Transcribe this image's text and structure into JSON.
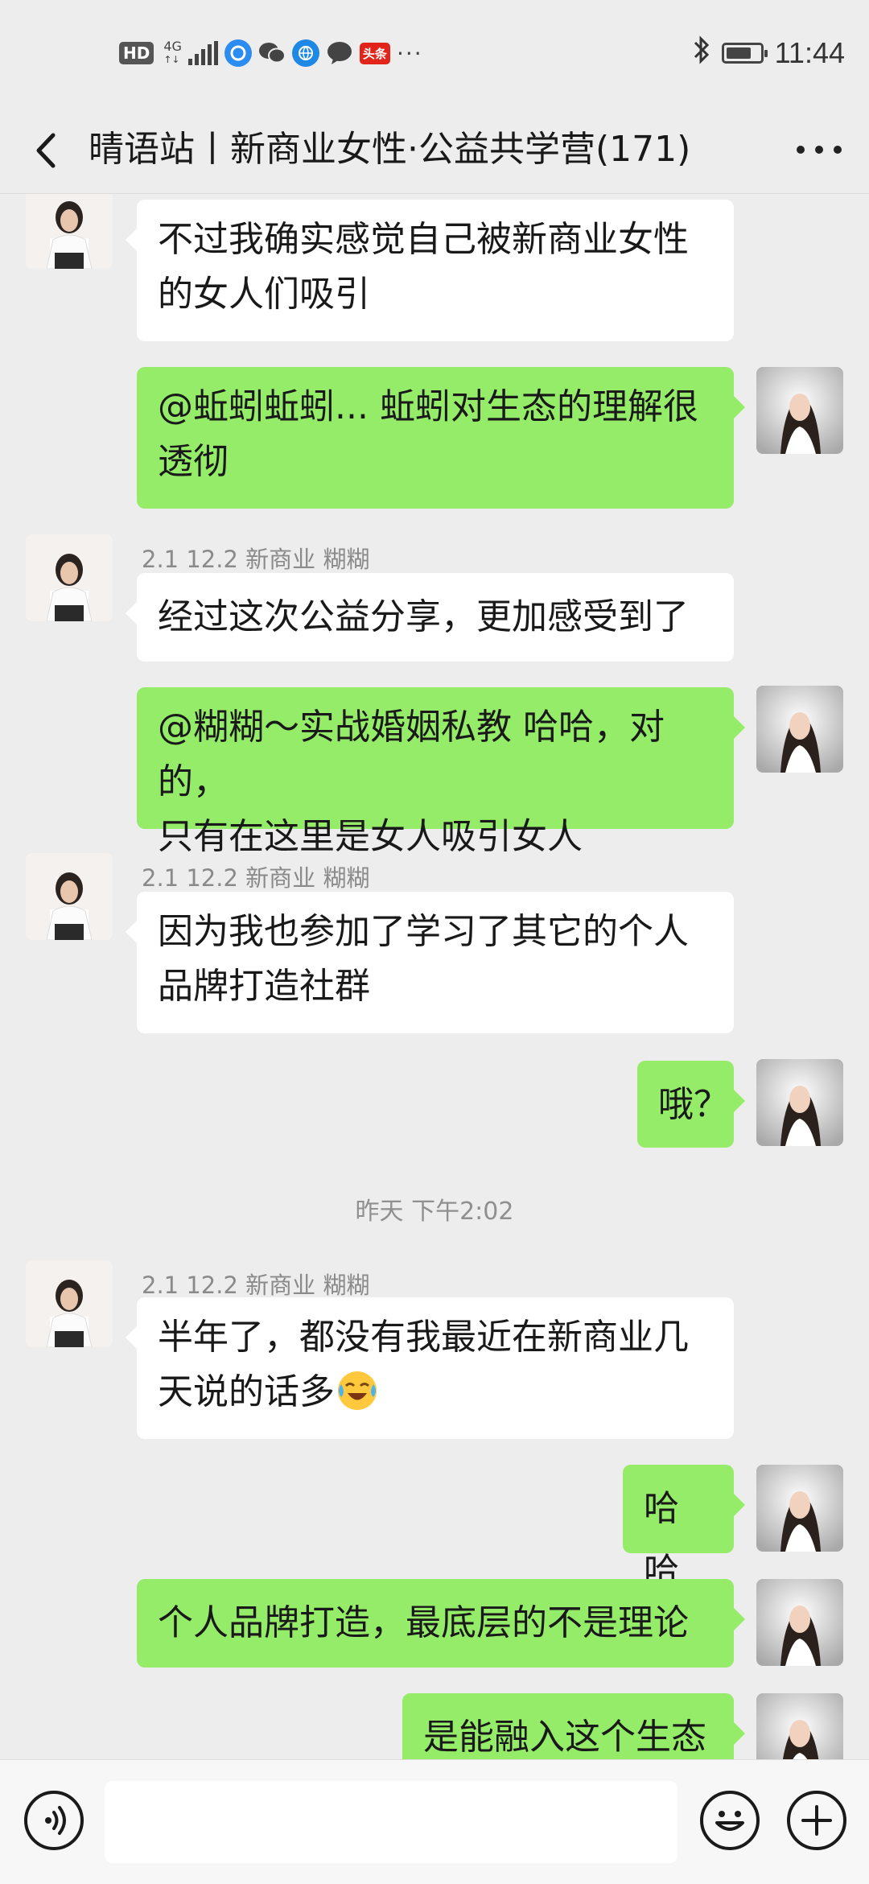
{
  "status_bar": {
    "hd_badge": "HD",
    "network": "4G",
    "network_sub": "↑↓",
    "news_badge": "头条",
    "more_dots": "···",
    "time": "11:44",
    "battery_level_pct": 75
  },
  "header": {
    "title": "晴语站丨新商业女性·公益共学营(171)"
  },
  "messages": [
    {
      "side": "in",
      "lines": [
        "不过我确实感觉自己被新商业女性",
        "的女人们吸引"
      ]
    },
    {
      "side": "out",
      "lines": [
        "@蚯蚓蚯蚓... 蚯蚓对生态的理解很",
        "透彻"
      ]
    },
    {
      "side": "in",
      "sender": "2.1 12.2 新商业 糊糊",
      "lines": [
        "经过这次公益分享，更加感受到了"
      ]
    },
    {
      "side": "out",
      "lines": [
        "@糊糊～实战婚姻私教 哈哈，对的，",
        "只有在这里是女人吸引女人"
      ]
    },
    {
      "side": "in",
      "sender": "2.1 12.2 新商业 糊糊",
      "lines": [
        "因为我也参加了学习了其它的个人",
        "品牌打造社群"
      ]
    },
    {
      "side": "out",
      "lines": [
        "哦？"
      ]
    },
    {
      "timestamp": "昨天 下午2:02"
    },
    {
      "side": "in",
      "sender": "2.1 12.2 新商业 糊糊",
      "lines": [
        "半年了，都没有我最近在新商业几",
        "天说的话多"
      ],
      "emoji": "laughing-crying-emoji"
    },
    {
      "side": "out",
      "lines": [
        "哈哈"
      ]
    },
    {
      "side": "out",
      "lines": [
        "个人品牌打造，最底层的不是理论"
      ]
    },
    {
      "side": "out",
      "lines": [
        "是能融入这个生态"
      ]
    }
  ],
  "input_bar": {
    "placeholder": "",
    "value": ""
  },
  "colors": {
    "background": "#ededed",
    "incoming_bubble": "#ffffff",
    "outgoing_bubble": "#95ec69",
    "meta_text": "#8a8a8a"
  }
}
